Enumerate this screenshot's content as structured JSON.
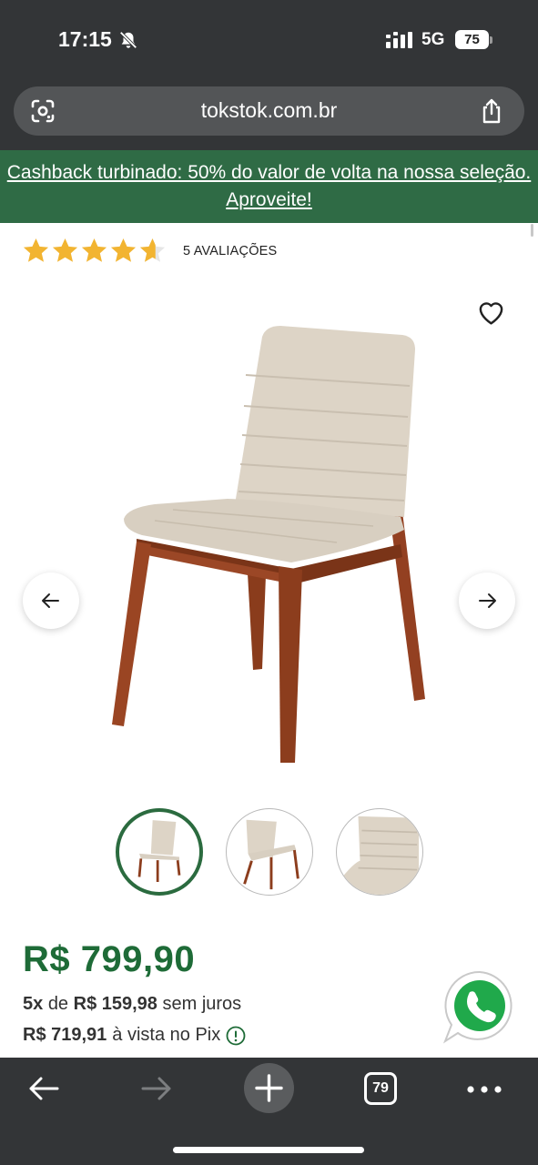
{
  "status_bar": {
    "time": "17:15",
    "network": "5G",
    "battery": "75"
  },
  "browser": {
    "url": "tokstok.com.br"
  },
  "promo_banner": {
    "text": "Cashback turbinado: 50% do valor de volta na nossa seleção. Aproveite!"
  },
  "product": {
    "rating": 4.6,
    "rating_count_label": "5 AVALIAÇÕES",
    "image_count": 3,
    "active_image_index": 0
  },
  "pricing": {
    "price": "R$ 799,90",
    "installment_count": "5x",
    "installment_de": "de",
    "installment_value": "R$ 159,98",
    "installment_suffix": "sem juros",
    "pix_price": "R$ 719,91",
    "pix_suffix": "à vista no Pix"
  },
  "toolbar": {
    "tab_count": "79"
  },
  "colors": {
    "brand_green": "#1e6b37",
    "banner_green": "#2f6b45",
    "star_gold": "#f2b431",
    "chrome_dark": "#333537"
  },
  "icons": [
    "bell-off-icon",
    "signal-icon",
    "battery-icon",
    "lens-icon",
    "share-icon",
    "heart-icon",
    "arrow-left-icon",
    "arrow-right-icon",
    "info-icon",
    "whatsapp-icon",
    "back-icon",
    "forward-icon",
    "plus-icon",
    "tabs-icon",
    "more-icon"
  ]
}
